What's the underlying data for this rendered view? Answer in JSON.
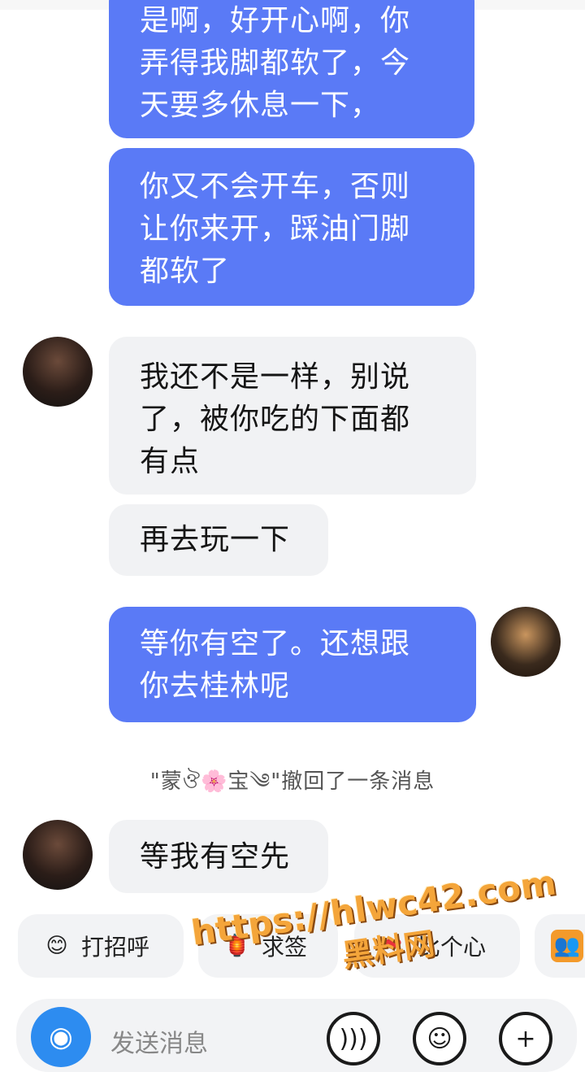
{
  "messages": [
    {
      "id": "m1",
      "direction": "sent",
      "lines": [
        "是啊，好开心啊，你",
        "弄得我脚都软了，今",
        "天要多休息一下，"
      ]
    },
    {
      "id": "m2",
      "direction": "sent",
      "lines": [
        "你又不会开车，否则",
        "让你来开，踩油门脚",
        "都软了"
      ]
    },
    {
      "id": "m3",
      "direction": "received",
      "lines": [
        "我还不是一样，别说",
        "了，被你吃的下面都",
        "有点"
      ]
    },
    {
      "id": "m4",
      "direction": "received",
      "lines": [
        "再去玩一下"
      ]
    },
    {
      "id": "m5",
      "direction": "sent",
      "lines": [
        "等你有空了。还想跟",
        "你去桂林呢"
      ]
    },
    {
      "id": "m6",
      "direction": "received",
      "lines": [
        "等我有空先"
      ]
    }
  ],
  "recall_notice": "\"蒙ঔ🌸宝༄\"撤回了一条消息",
  "quick_replies": [
    {
      "label": "打招呼",
      "icon": "😊"
    },
    {
      "label": "求签",
      "icon": "🏮"
    },
    {
      "label": "比个心",
      "icon": "❤"
    },
    {
      "label": "",
      "icon": "👥"
    }
  ],
  "input": {
    "placeholder": "发送消息"
  },
  "watermark": {
    "url": "https://hlwc42.com",
    "name": "黑料网"
  },
  "colors": {
    "sent_bubble": "#5a7af6",
    "received_bubble": "#f1f2f4",
    "accent": "#2d8cf0"
  }
}
